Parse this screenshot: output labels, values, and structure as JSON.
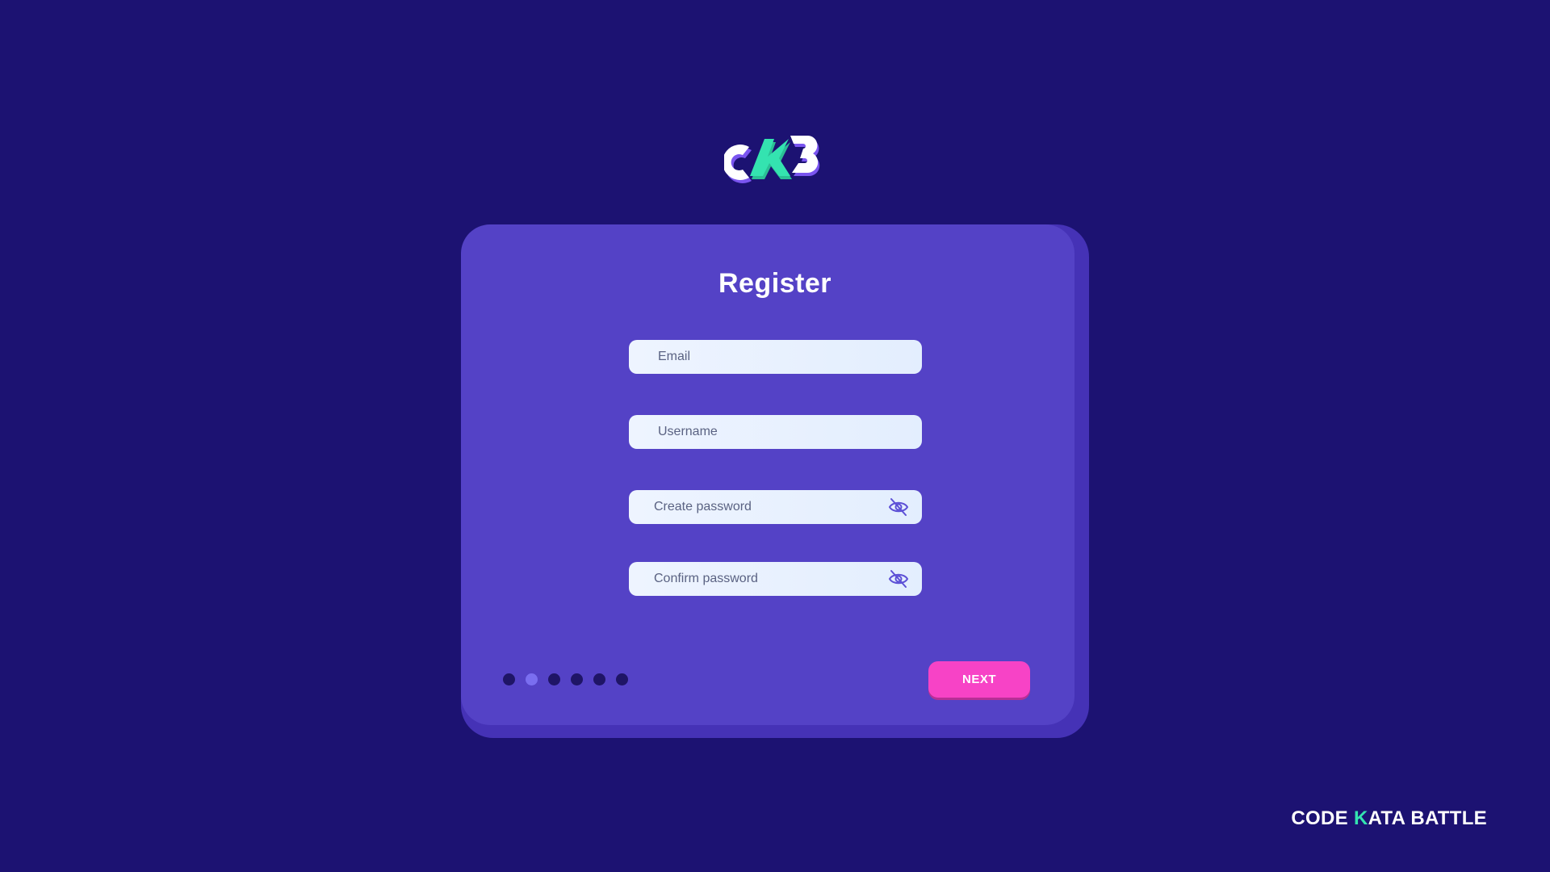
{
  "logo": {
    "name": "ckb-logo-icon"
  },
  "form": {
    "title": "Register",
    "email_placeholder": "Email",
    "username_placeholder": "Username",
    "password_placeholder": "Create password",
    "confirm_placeholder": "Confirm password"
  },
  "stepper": {
    "total_steps": 6,
    "active_step": 2
  },
  "actions": {
    "next_label": "NEXT"
  },
  "brand": {
    "part1": "CODE",
    "part2": "K",
    "part3": "ATA BATTLE"
  },
  "colors": {
    "background": "#1c1272",
    "card": "#5442c6",
    "accent_pink": "#f743c6",
    "accent_green": "#34e3b0"
  }
}
